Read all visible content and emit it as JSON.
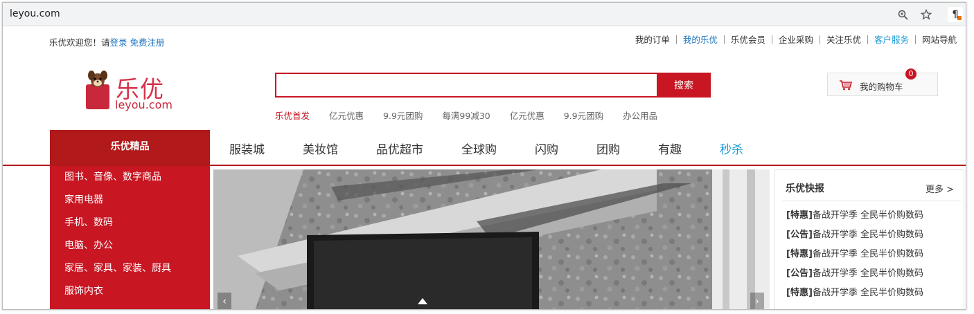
{
  "browser": {
    "url": "leyou.com"
  },
  "topbar": {
    "welcome_prefix": "乐优欢迎您！请",
    "login": "登录",
    "register": "免费注册",
    "links": [
      {
        "label": "我的订单",
        "style": ""
      },
      {
        "label": "我的乐优",
        "style": "blue"
      },
      {
        "label": "乐优会员",
        "style": ""
      },
      {
        "label": "企业采购",
        "style": ""
      },
      {
        "label": "关注乐优",
        "style": ""
      },
      {
        "label": "客户服务",
        "style": "cyan"
      },
      {
        "label": "网站导航",
        "style": ""
      }
    ]
  },
  "logo": {
    "text": "乐优",
    "domain": "leyou.com"
  },
  "search": {
    "value": "",
    "button": "搜索",
    "hotwords": [
      "乐优首发",
      "亿元优惠",
      "9.9元团购",
      "每满99减30",
      "亿元优惠",
      "9.9元团购",
      "办公用品"
    ]
  },
  "cart": {
    "label": "我的购物车",
    "count": "0"
  },
  "nav": {
    "category_title": "乐优精品",
    "links": [
      "服装城",
      "美妆馆",
      "品优超市",
      "全球购",
      "闪购",
      "团购",
      "有趣",
      "秒杀"
    ]
  },
  "categories": [
    "图书、音像、数字商品",
    "家用电器",
    "手机、数码",
    "电脑、办公",
    "家居、家具、家装、厨具",
    "服饰内衣"
  ],
  "news": {
    "title": "乐优快报",
    "more": "更多 >",
    "items": [
      {
        "tag": "[特惠]",
        "text": "备战开学季 全民半价购数码"
      },
      {
        "tag": "[公告]",
        "text": "备战开学季 全民半价购数码"
      },
      {
        "tag": "[特惠]",
        "text": "备战开学季 全民半价购数码"
      },
      {
        "tag": "[公告]",
        "text": "备战开学季 全民半价购数码"
      },
      {
        "tag": "[特惠]",
        "text": "备战开学季 全民半价购数码"
      }
    ]
  },
  "colors": {
    "brand_red": "#c81623",
    "dark_red": "#b1191a",
    "link_blue": "#1e73be"
  }
}
